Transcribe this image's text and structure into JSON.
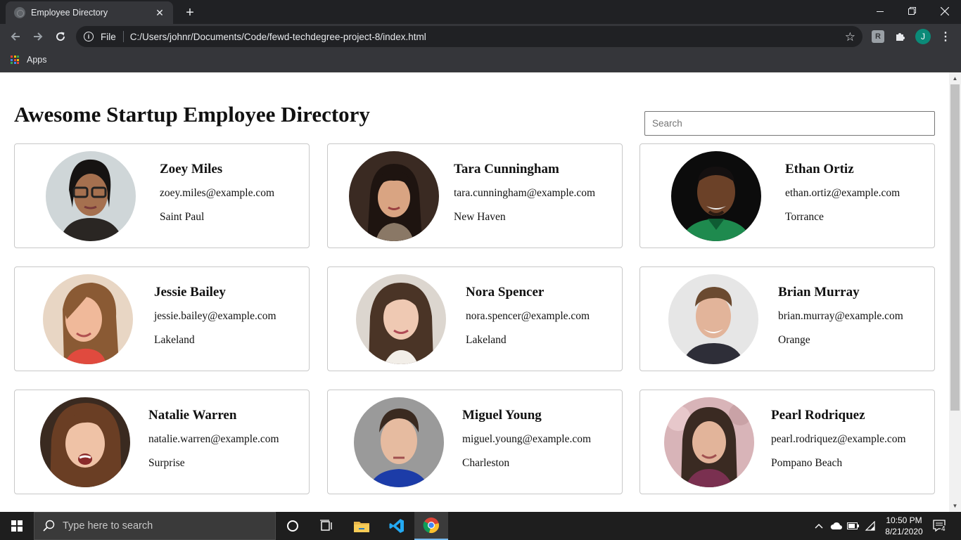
{
  "browser": {
    "tab_title": "Employee Directory",
    "scheme_label": "File",
    "url": "C:/Users/johnr/Documents/Code/fewd-techdegree-project-8/index.html",
    "bookmarks": {
      "apps_label": "Apps"
    },
    "profile_initial": "J",
    "extension_label": "R"
  },
  "page": {
    "title": "Awesome Startup Employee Directory",
    "search_placeholder": "Search",
    "employees": [
      {
        "name": "Zoey Miles",
        "email": "zoey.miles@example.com",
        "city": "Saint Paul"
      },
      {
        "name": "Tara Cunningham",
        "email": "tara.cunningham@example.com",
        "city": "New Haven"
      },
      {
        "name": "Ethan Ortiz",
        "email": "ethan.ortiz@example.com",
        "city": "Torrance"
      },
      {
        "name": "Jessie Bailey",
        "email": "jessie.bailey@example.com",
        "city": "Lakeland"
      },
      {
        "name": "Nora Spencer",
        "email": "nora.spencer@example.com",
        "city": "Lakeland"
      },
      {
        "name": "Brian Murray",
        "email": "brian.murray@example.com",
        "city": "Orange"
      },
      {
        "name": "Natalie Warren",
        "email": "natalie.warren@example.com",
        "city": "Surprise"
      },
      {
        "name": "Miguel Young",
        "email": "miguel.young@example.com",
        "city": "Charleston"
      },
      {
        "name": "Pearl Rodriquez",
        "email": "pearl.rodriquez@example.com",
        "city": "Pompano Beach"
      }
    ]
  },
  "taskbar": {
    "search_placeholder": "Type here to search",
    "time": "10:50 PM",
    "date": "8/21/2020",
    "notification_count": "4"
  },
  "colors": {
    "chrome_dark": "#202124",
    "chrome_toolbar": "#35363a",
    "profile_avatar": "#0b8a78",
    "card_border": "#c8c8c8",
    "taskbar": "#1e1e1e"
  }
}
